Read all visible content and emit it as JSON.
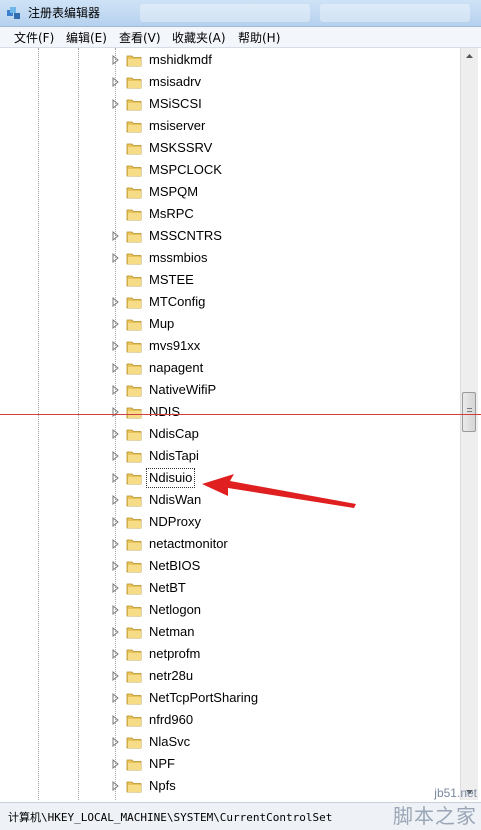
{
  "window": {
    "title": "注册表编辑器"
  },
  "menu": {
    "items": [
      "文件(F)",
      "编辑(E)",
      "查看(V)",
      "收藏夹(A)",
      "帮助(H)"
    ]
  },
  "tree": {
    "selected": "Ndisuio",
    "items": [
      {
        "label": "mshidkmdf",
        "has_children": true
      },
      {
        "label": "msisadrv",
        "has_children": true
      },
      {
        "label": "MSiSCSI",
        "has_children": true
      },
      {
        "label": "msiserver",
        "has_children": false
      },
      {
        "label": "MSKSSRV",
        "has_children": false
      },
      {
        "label": "MSPCLOCK",
        "has_children": false
      },
      {
        "label": "MSPQM",
        "has_children": false
      },
      {
        "label": "MsRPC",
        "has_children": false
      },
      {
        "label": "MSSCNTRS",
        "has_children": true
      },
      {
        "label": "mssmbios",
        "has_children": true
      },
      {
        "label": "MSTEE",
        "has_children": false
      },
      {
        "label": "MTConfig",
        "has_children": true
      },
      {
        "label": "Mup",
        "has_children": true
      },
      {
        "label": "mvs91xx",
        "has_children": true
      },
      {
        "label": "napagent",
        "has_children": true
      },
      {
        "label": "NativeWifiP",
        "has_children": true
      },
      {
        "label": "NDIS",
        "has_children": true
      },
      {
        "label": "NdisCap",
        "has_children": true
      },
      {
        "label": "NdisTapi",
        "has_children": true
      },
      {
        "label": "Ndisuio",
        "has_children": true
      },
      {
        "label": "NdisWan",
        "has_children": true
      },
      {
        "label": "NDProxy",
        "has_children": true
      },
      {
        "label": "netactmonitor",
        "has_children": true
      },
      {
        "label": "NetBIOS",
        "has_children": true
      },
      {
        "label": "NetBT",
        "has_children": true
      },
      {
        "label": "Netlogon",
        "has_children": true
      },
      {
        "label": "Netman",
        "has_children": true
      },
      {
        "label": "netprofm",
        "has_children": true
      },
      {
        "label": "netr28u",
        "has_children": true
      },
      {
        "label": "NetTcpPortSharing",
        "has_children": true
      },
      {
        "label": "nfrd960",
        "has_children": true
      },
      {
        "label": "NlaSvc",
        "has_children": true
      },
      {
        "label": "NPF",
        "has_children": true
      },
      {
        "label": "Npfs",
        "has_children": true
      }
    ]
  },
  "status": {
    "path": "计算机\\HKEY_LOCAL_MACHINE\\SYSTEM\\CurrentControlSet"
  },
  "watermark": {
    "url": "jb51.net",
    "text": "脚本之家"
  },
  "colors": {
    "folder": "#e8c45a",
    "annotation_arrow": "#e02020",
    "guide_line": "#d04040"
  }
}
